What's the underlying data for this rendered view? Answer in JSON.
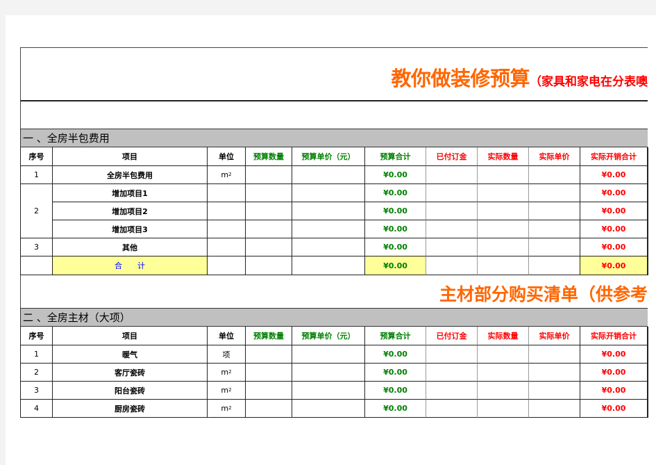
{
  "title": {
    "main": "教你做装修预算",
    "sub": "（家具和家电在分表噢"
  },
  "section1": {
    "label": "一 、全房半包费用",
    "columns": [
      "序号",
      "项目",
      "单位",
      "预算数量",
      "预算单价（元）",
      "预算合计",
      "已付订金",
      "实际数量",
      "实际单价",
      "实际开销合计"
    ],
    "rows": [
      {
        "no": "1",
        "item": "全房半包费用",
        "unit": "m",
        "unit_sup": "2",
        "budget_total": "¥0.00",
        "actual_total": "¥0.00"
      },
      {
        "no": "2",
        "item": "增加项目1",
        "unit": "",
        "unit_sup": "",
        "budget_total": "¥0.00",
        "actual_total": "¥0.00"
      },
      {
        "no": "",
        "item": "增加项目2",
        "unit": "",
        "unit_sup": "",
        "budget_total": "¥0.00",
        "actual_total": "¥0.00"
      },
      {
        "no": "",
        "item": "增加项目3",
        "unit": "",
        "unit_sup": "",
        "budget_total": "¥0.00",
        "actual_total": "¥0.00"
      },
      {
        "no": "3",
        "item": "其他",
        "unit": "",
        "unit_sup": "",
        "budget_total": "¥0.00",
        "actual_total": "¥0.00"
      }
    ],
    "total": {
      "label": "合　　计",
      "budget_total": "¥0.00",
      "actual_total": "¥0.00"
    }
  },
  "banner2": "主材部分购买清单（供参考",
  "section2": {
    "label": "二 、全房主材（大项）",
    "columns": [
      "序号",
      "项目",
      "单位",
      "预算数量",
      "预算单价（元）",
      "预算合计",
      "已付订金",
      "实际数量",
      "实际单价",
      "实际开销合计"
    ],
    "rows": [
      {
        "no": "1",
        "item": "暖气",
        "unit": "项",
        "unit_sup": "",
        "budget_total": "¥0.00",
        "actual_total": "¥0.00"
      },
      {
        "no": "2",
        "item": "客厅瓷砖",
        "unit": "m",
        "unit_sup": "2",
        "budget_total": "¥0.00",
        "actual_total": "¥0.00"
      },
      {
        "no": "3",
        "item": "阳台瓷砖",
        "unit": "m",
        "unit_sup": "2",
        "budget_total": "¥0.00",
        "actual_total": "¥0.00"
      },
      {
        "no": "4",
        "item": "厨房瓷砖",
        "unit": "m",
        "unit_sup": "2",
        "budget_total": "¥0.00",
        "actual_total": "¥0.00"
      }
    ]
  },
  "colors": {
    "title_orange": "#ff6600",
    "subtitle_red": "#ff0000",
    "budget_green": "#008000",
    "actual_red": "#ff0000",
    "total_yellow": "#ffff99",
    "section_gray": "#c0c0c0"
  }
}
